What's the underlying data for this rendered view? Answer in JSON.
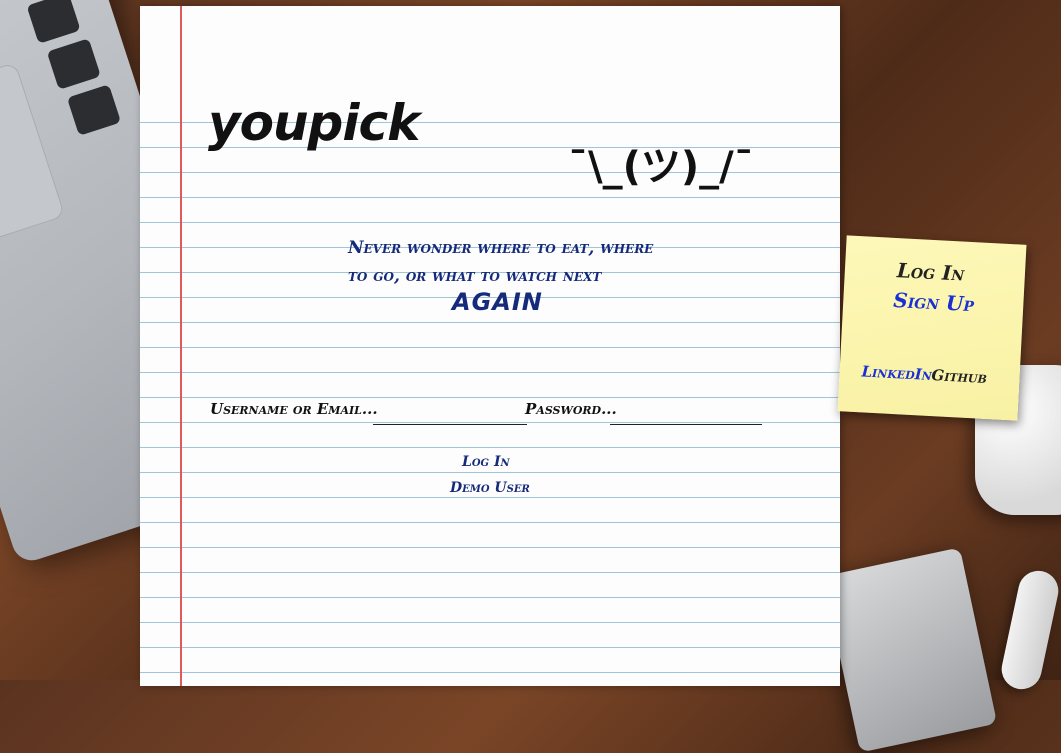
{
  "brand": {
    "logo": "youpick",
    "shrug": "¯\\_(ツ)_/¯"
  },
  "tagline": {
    "line1": "Never wonder where to eat, where",
    "line2": "to go, or what to watch next",
    "emphasis": "AGAIN"
  },
  "login_form": {
    "username_label": "Username or Email...",
    "username_value": "",
    "password_label": "Password...",
    "password_value": "",
    "login_label": "Log In",
    "demo_label": "Demo User"
  },
  "sticky_note": {
    "login_label": "Log In",
    "signup_label": "Sign Up",
    "linkedin_label": "LinkedIn",
    "github_label": "Github"
  },
  "colors": {
    "ink_blue": "#152a7a",
    "link_blue": "#1a2fd6",
    "margin_red": "#e05a5a",
    "rule_blue": "#9fc6d8",
    "sticky_yellow": "#fdf8b8"
  }
}
